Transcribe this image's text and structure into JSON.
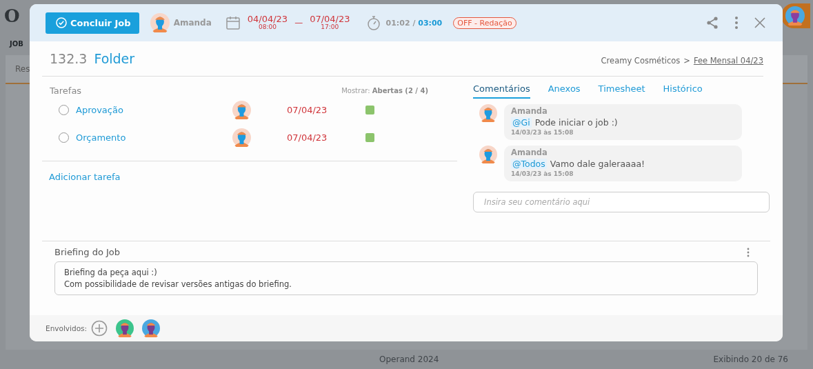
{
  "background": {
    "logo": "O",
    "section": "JOB",
    "tab": "Res",
    "footer_left": "Operand 2024",
    "footer_right": "Exibindo 20 de 76"
  },
  "header": {
    "complete_button": "Concluir Job",
    "owner": "Amanda",
    "start_date": "04/04/23",
    "start_time": "08:00",
    "date_separator": "—",
    "end_date": "07/04/23",
    "end_time": "17:00",
    "time_spent": "01:02",
    "time_separator": "/",
    "time_estimated": "03:00",
    "status_tag": "OFF - Redação"
  },
  "job": {
    "number": "132.3",
    "title": "Folder",
    "client": "Creamy Cosméticos",
    "breadcrumb_separator": ">",
    "project": "Fee Mensal 04/23"
  },
  "tasks": {
    "title": "Tarefas",
    "filter_label": "Mostrar:",
    "filter_value": "Abertas (2 / 4)",
    "add_link": "Adicionar tarefa",
    "items": [
      {
        "name": "Aprovação",
        "done": false,
        "due": "07/04/23",
        "color": "#8cc46c"
      },
      {
        "name": "Orçamento",
        "done": false,
        "due": "07/04/23",
        "color": "#8cc46c"
      }
    ]
  },
  "tabs": [
    {
      "label": "Comentários",
      "selected": true
    },
    {
      "label": "Anexos",
      "selected": false
    },
    {
      "label": "Timesheet",
      "selected": false
    },
    {
      "label": "Histórico",
      "selected": false
    }
  ],
  "comments": [
    {
      "author": "Amanda",
      "mention": "@Gi",
      "text": "Pode iniciar o job :)",
      "time": "14/03/23 às 15:08"
    },
    {
      "author": "Amanda",
      "mention": "@Todos",
      "text": "Vamo dale galeraaaa!",
      "time": "14/03/23 às 15:08"
    }
  ],
  "comment_field": {
    "placeholder": "Insira seu comentário aqui"
  },
  "briefing": {
    "title": "Briefing do Job",
    "lines": [
      "Briefing da peça aqui :)",
      "Com possibilidade de revisar versões antigas do briefing."
    ]
  },
  "involved": {
    "label": "Envolvidos:",
    "people": [
      {
        "color": "#3cc48c"
      },
      {
        "color": "#4aa8e0"
      }
    ]
  }
}
